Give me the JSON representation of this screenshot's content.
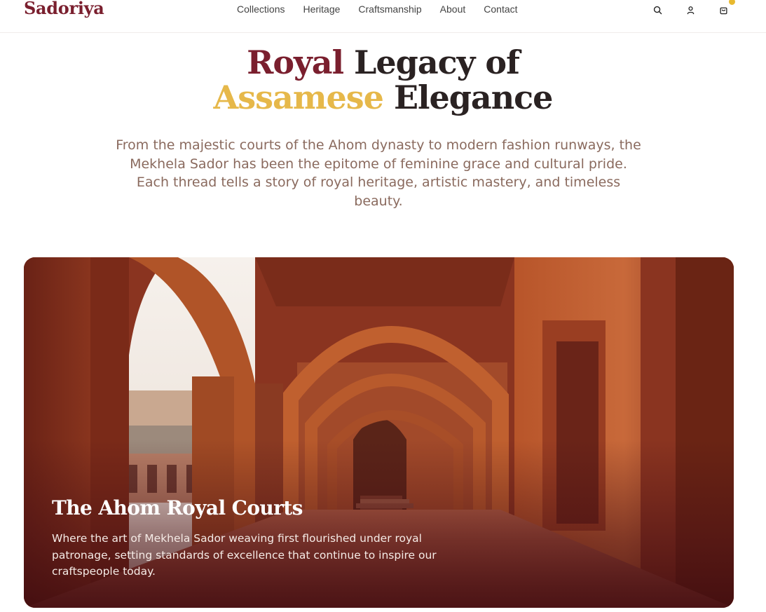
{
  "nav": {
    "brand": "Sadoriya",
    "links": [
      "Collections",
      "Heritage",
      "Craftsmanship",
      "About",
      "Contact"
    ],
    "icons": [
      "search-icon",
      "user-icon",
      "shopping-bag-icon"
    ]
  },
  "hero": {
    "title_word1": "Royal",
    "title_part2": " Legacy of",
    "title_word3": "Assamese",
    "title_part4": " Elegance",
    "subtitle": "From the majestic courts of the Ahom dynasty to modern fashion runways, the Mekhela Sador has been the epitome of feminine grace and cultural pride. Each thread tells a story of royal heritage, artistic mastery, and timeless beauty."
  },
  "feature_card": {
    "title": "The Ahom Royal Courts",
    "text": "Where the art of Mekhela Sador weaving first flourished under royal patronage, setting standards of excellence that continue to inspire our craftspeople today."
  },
  "colors": {
    "brand_maroon": "#7a1f2e",
    "accent_gold": "#e6b84a",
    "cart_badge": "#e8b92f"
  }
}
